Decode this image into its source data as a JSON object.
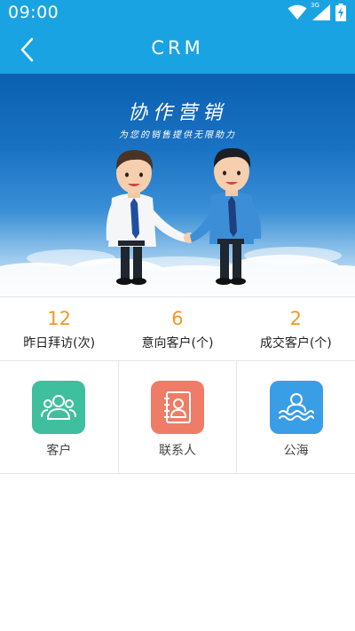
{
  "status_bar": {
    "time": "09:00",
    "network": "3G",
    "icons": [
      "wifi-icon",
      "signal-icon",
      "battery-charging-icon"
    ]
  },
  "nav": {
    "title": "CRM",
    "back_icon": "chevron-left-icon"
  },
  "banner": {
    "title": "协作营销",
    "subtitle": "为您的销售提供无限助力"
  },
  "stats": [
    {
      "value": "12",
      "label": "昨日拜访(次)"
    },
    {
      "value": "6",
      "label": "意向客户(个)"
    },
    {
      "value": "2",
      "label": "成交客户(个)"
    }
  ],
  "menu": [
    {
      "label": "客户",
      "icon": "customers-icon",
      "color": "#3fbf9d"
    },
    {
      "label": "联系人",
      "icon": "contact-book-icon",
      "color": "#ee7c67"
    },
    {
      "label": "公海",
      "icon": "public-sea-icon",
      "color": "#3a9ee6"
    }
  ],
  "colors": {
    "primary": "#1aa3e3",
    "accent": "#f09a22"
  }
}
